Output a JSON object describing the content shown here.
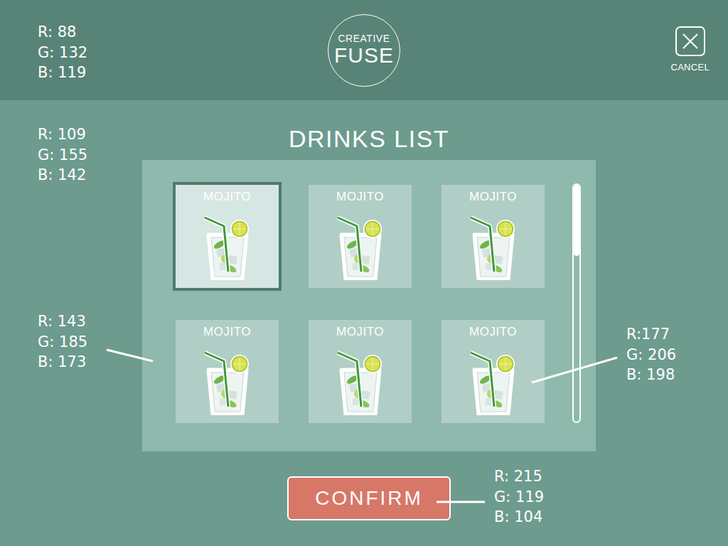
{
  "header": {
    "logo": [
      "CREATIVE",
      "FUSE"
    ],
    "cancel": "CANCEL"
  },
  "title": "DRINKS LIST",
  "drinks": [
    {
      "label": "MOJITO",
      "selected": true
    },
    {
      "label": "MOJITO",
      "selected": false
    },
    {
      "label": "MOJITO",
      "selected": false
    },
    {
      "label": "MOJITO",
      "selected": false
    },
    {
      "label": "MOJITO",
      "selected": false
    },
    {
      "label": "MOJITO",
      "selected": false
    }
  ],
  "scrollbar": {
    "level": 0.3
  },
  "confirm": "CONFIRM",
  "annotations": [
    {
      "lines": [
        "R: 88",
        "G: 132",
        "B: 119"
      ]
    },
    {
      "lines": [
        "R: 109",
        "G: 155",
        "B: 142"
      ]
    },
    {
      "lines": [
        "R: 143",
        "G: 185",
        "B: 173"
      ]
    },
    {
      "lines": [
        "R:177",
        "G: 206",
        "B: 198"
      ]
    },
    {
      "lines": [
        "R: 215",
        "G: 119",
        "B: 104"
      ]
    }
  ]
}
